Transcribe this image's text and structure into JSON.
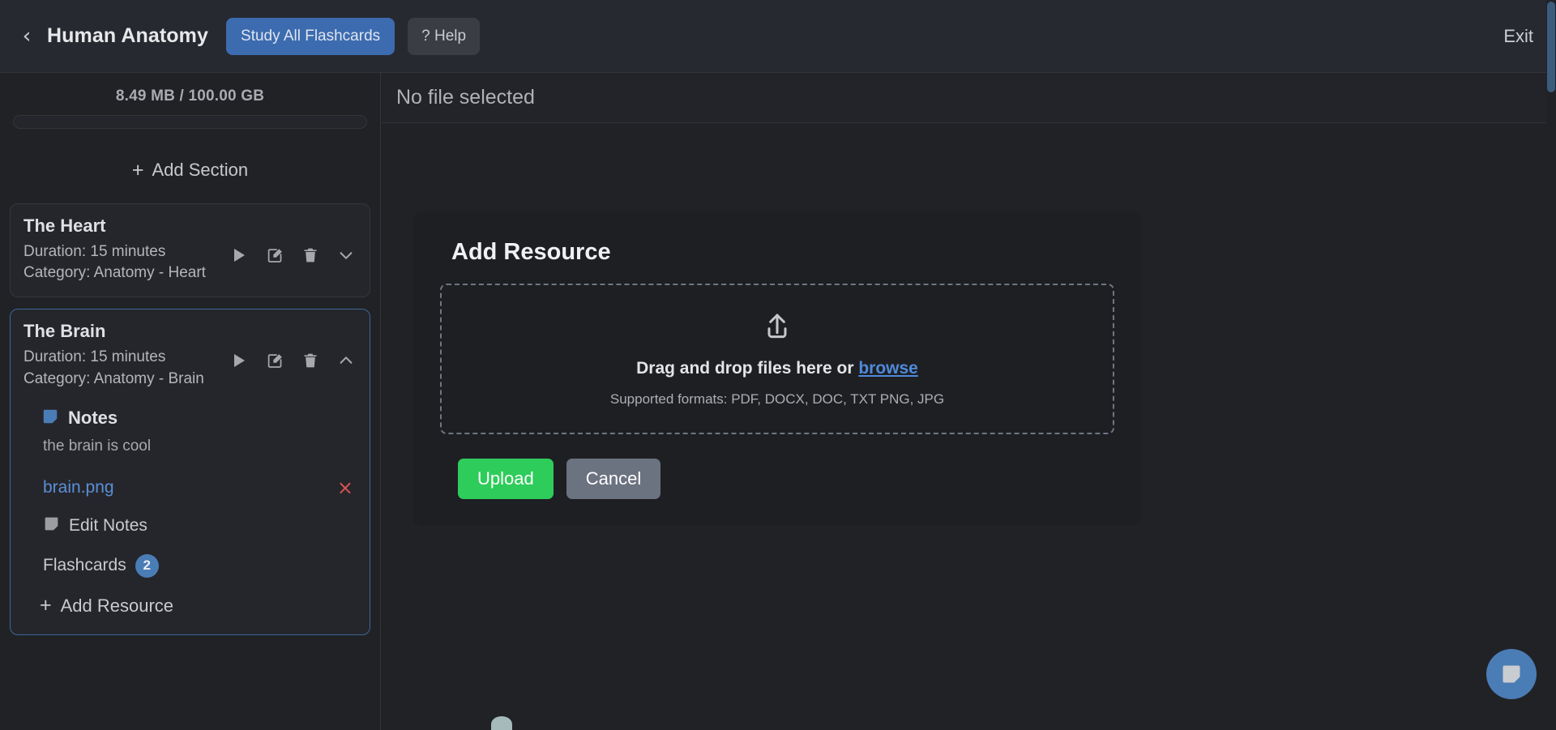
{
  "topbar": {
    "back_icon": "chevron-left-icon",
    "course_title": "Human Anatomy",
    "study_all_label": "Study All Flashcards",
    "help_label": "? Help",
    "exit_label": "Exit",
    "accent_blue": "#3c6bb0",
    "help_bg": "#3a3d44"
  },
  "sidebar": {
    "storage": {
      "label": "8.49 MB / 100.00 GB",
      "used_mb": 8.49,
      "total_gb": 100.0,
      "percent": 0
    },
    "add_section_label": "Add Section",
    "sections": [
      {
        "title": "The Heart",
        "duration": "Duration: 15 minutes",
        "category": "Category: Anatomy - Heart",
        "expanded": false,
        "selected": false,
        "actions": [
          "play-icon",
          "edit-icon",
          "trash-icon",
          "chevron-down-icon"
        ]
      },
      {
        "title": "The Brain",
        "duration": "Duration: 15 minutes",
        "category": "Category: Anatomy - Brain",
        "expanded": true,
        "selected": true,
        "actions": [
          "play-icon",
          "edit-icon",
          "trash-icon",
          "chevron-up-icon"
        ],
        "notes_title": "Notes",
        "notes_text": "the brain is cool",
        "resources": [
          {
            "name": "brain.png",
            "remove_label": "×"
          }
        ],
        "edit_notes_label": "Edit Notes",
        "flashcards_label": "Flashcards",
        "flashcards_count": "2",
        "add_resource_label": "Add Resource"
      }
    ]
  },
  "main": {
    "no_file_selected": "No file selected",
    "background_cut_text": "ction"
  },
  "modal": {
    "title": "Add Resource",
    "dropzone": {
      "icon": "upload-icon",
      "main_text": "Drag and drop files here or",
      "browse_label": "browse",
      "supported_formats": "Supported formats: PDF, DOCX, DOC, TXT PNG, JPG"
    },
    "upload_label": "Upload",
    "cancel_label": "Cancel",
    "upload_color": "#2ecc5a",
    "cancel_color": "#6b7280"
  },
  "fab": {
    "icon": "note-icon",
    "color": "#4a7db5"
  }
}
